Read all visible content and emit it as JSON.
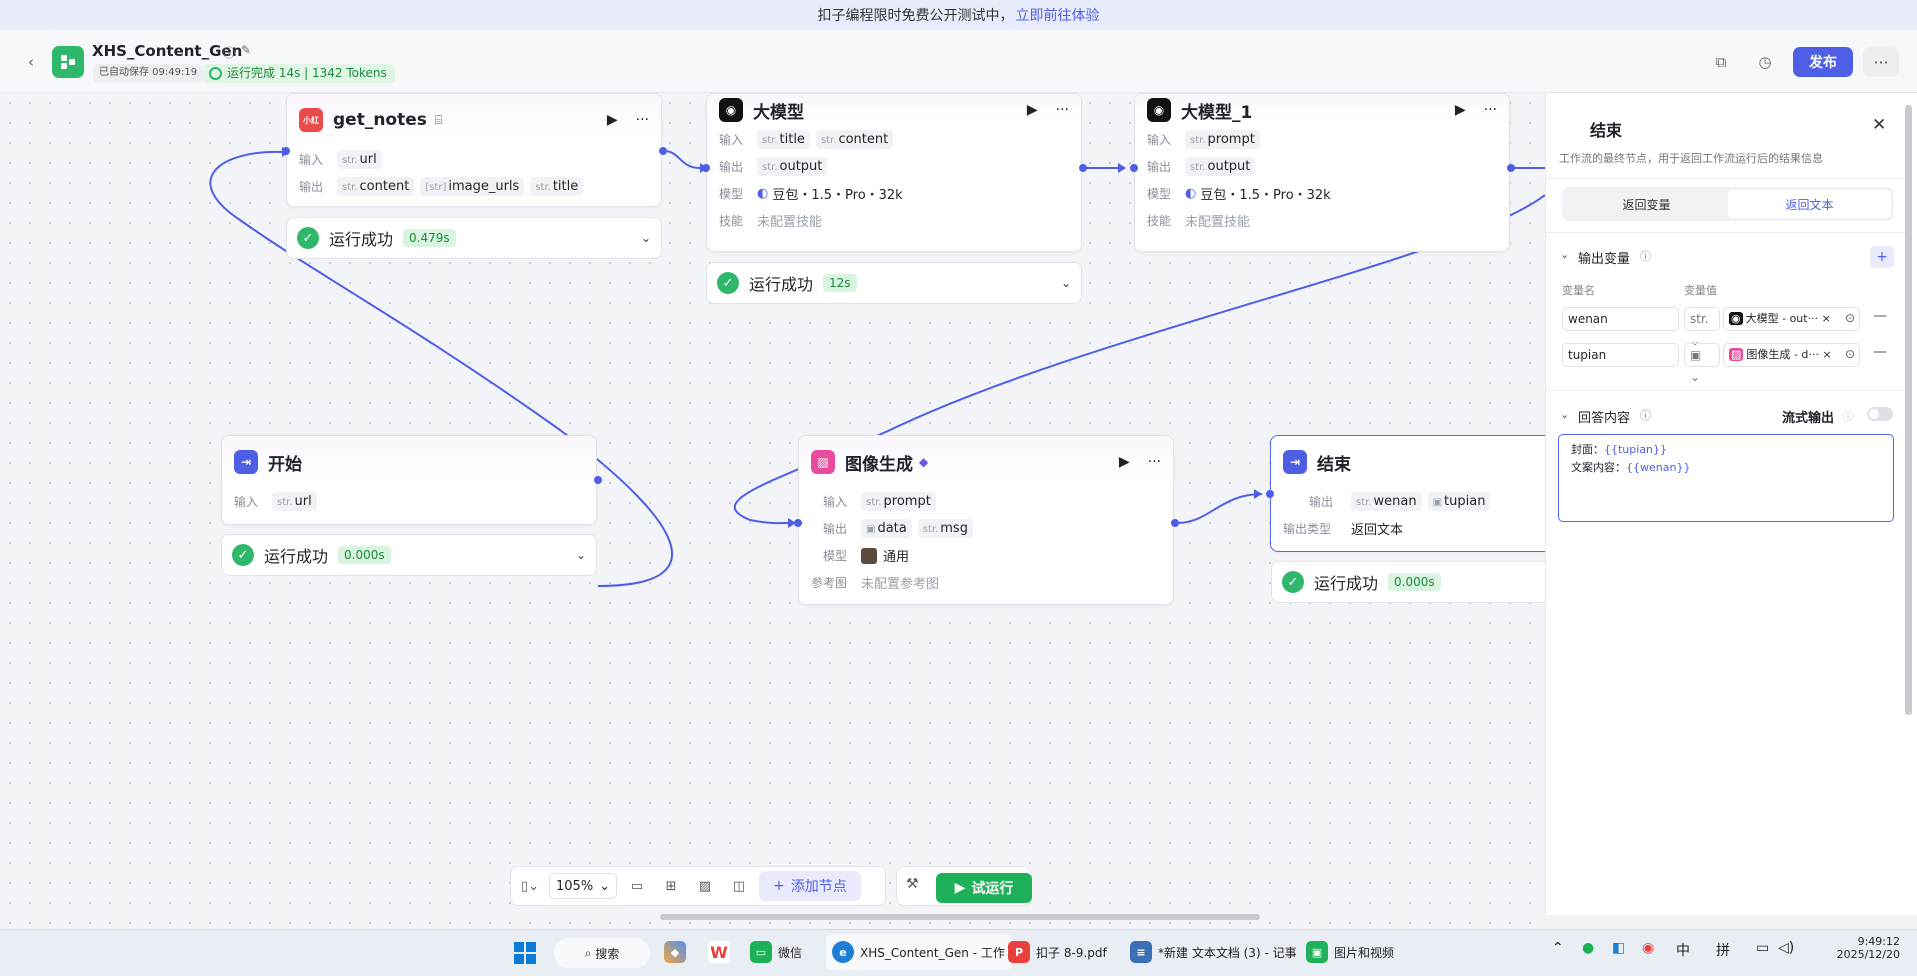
{
  "banner": {
    "text": "扣子编程限时免费公开测试中，",
    "link": "立即前往体验"
  },
  "header": {
    "title": "XHS_Content_Gen",
    "autosave": "已自动保存 09:49:19",
    "run_status": "运行完成 14s | 1342 Tokens",
    "publish_label": "发布"
  },
  "nodes": {
    "get_notes": {
      "title": "get_notes",
      "input_label": "输入",
      "output_label": "输出",
      "inputs": [
        {
          "type": "str.",
          "name": "url"
        }
      ],
      "outputs": [
        {
          "type": "str.",
          "name": "content"
        },
        {
          "type": "[str]",
          "name": "image_urls"
        },
        {
          "type": "str.",
          "name": "title"
        }
      ],
      "status": "运行成功",
      "time": "0.479s"
    },
    "llm": {
      "title": "大模型",
      "input_label": "输入",
      "output_label": "输出",
      "model_label": "模型",
      "skill_label": "技能",
      "inputs": [
        {
          "type": "str.",
          "name": "title"
        },
        {
          "type": "str.",
          "name": "content"
        }
      ],
      "outputs": [
        {
          "type": "str.",
          "name": "output"
        }
      ],
      "model": "豆包・1.5・Pro・32k",
      "skill": "未配置技能",
      "status": "运行成功",
      "time": "12s"
    },
    "llm1": {
      "title": "大模型_1",
      "input_label": "输入",
      "output_label": "输出",
      "model_label": "模型",
      "skill_label": "技能",
      "inputs": [
        {
          "type": "str.",
          "name": "prompt"
        }
      ],
      "outputs": [
        {
          "type": "str.",
          "name": "output"
        }
      ],
      "model": "豆包・1.5・Pro・32k",
      "skill": "未配置技能"
    },
    "start": {
      "title": "开始",
      "input_label": "输入",
      "inputs": [
        {
          "type": "str.",
          "name": "url"
        }
      ],
      "status": "运行成功",
      "time": "0.000s"
    },
    "image": {
      "title": "图像生成",
      "input_label": "输入",
      "output_label": "输出",
      "model_label": "模型",
      "ref_label": "参考图",
      "inputs": [
        {
          "type": "str.",
          "name": "prompt"
        }
      ],
      "outputs": [
        {
          "type": "img",
          "name": "data"
        },
        {
          "type": "str.",
          "name": "msg"
        }
      ],
      "model": "通用",
      "ref": "未配置参考图"
    },
    "end": {
      "title": "结束",
      "output_label": "输出",
      "output_type_label": "输出类型",
      "outputs": [
        {
          "type": "str.",
          "name": "wenan"
        },
        {
          "type": "img",
          "name": "tupian"
        }
      ],
      "output_type": "返回文本",
      "status": "运行成功",
      "time": "0.000s"
    }
  },
  "panel": {
    "title": "结束",
    "desc": "工作流的最终节点，用于返回工作流运行后的结果信息",
    "tabs": [
      "返回变量",
      "返回文本"
    ],
    "active_tab": 1,
    "output_vars_title": "输出变量",
    "col_name": "变量名",
    "col_value": "变量值",
    "vars": [
      {
        "name": "wenan",
        "type": "str.",
        "ref": "大模型 - out···"
      },
      {
        "name": "tupian",
        "type": "img",
        "ref": "图像生成 - d···"
      }
    ],
    "answer_title": "回答内容",
    "stream_label": "流式输出",
    "answer_lines": [
      {
        "label": "封面：",
        "var": "{{tupian}}"
      },
      {
        "label": "文案内容：",
        "var": "{{wenan}}"
      }
    ]
  },
  "toolbar": {
    "zoom": "105%",
    "add_node": "添加节点",
    "test_run": "试运行"
  },
  "taskbar": {
    "search": "搜索",
    "apps": [
      "微信",
      "XHS_Content_Gen - 工作",
      "扣子 8-9.pdf",
      "*新建 文本文档 (3) - 记事",
      "图片和视频"
    ],
    "ime1": "中",
    "ime2": "拼",
    "time": "9:49:12",
    "date": "2025/12/20"
  }
}
